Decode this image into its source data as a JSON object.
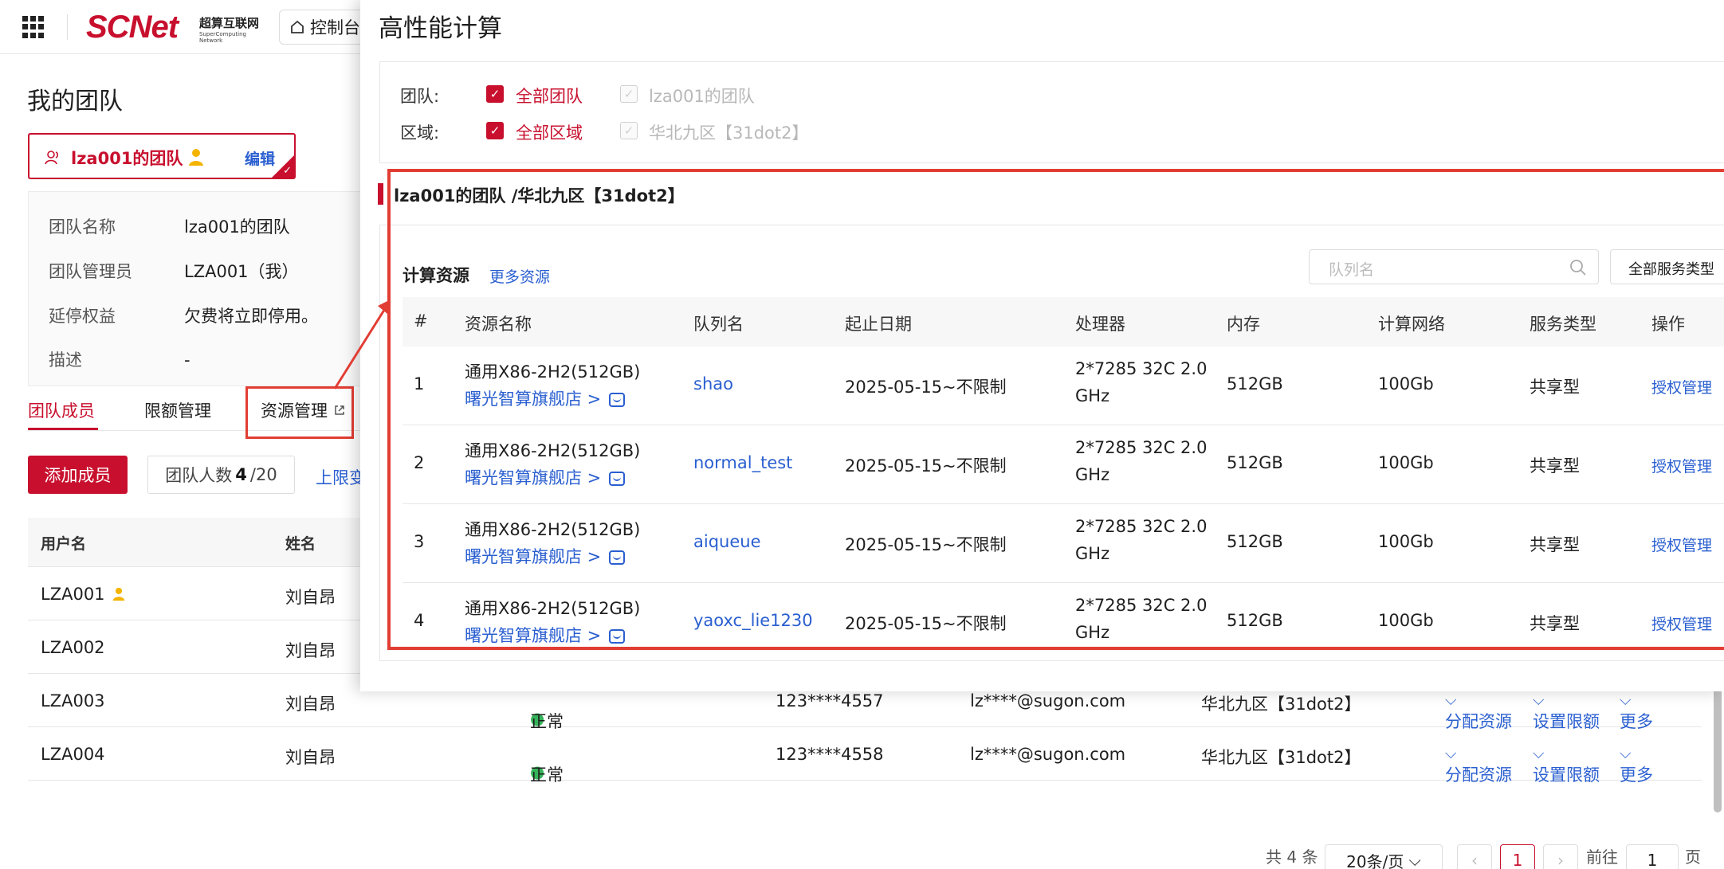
{
  "header": {
    "logo": "SCNet",
    "logo_cn": "超算互联网",
    "logo_en_1": "SuperComputing",
    "logo_en_2": "Network",
    "console_label": "控制台"
  },
  "page": {
    "title": "我的团队",
    "team_card": {
      "name": "lza001的团队",
      "edit_label": "编辑"
    },
    "info": [
      {
        "key": "团队名称",
        "value": "lza001的团队"
      },
      {
        "key": "团队管理员",
        "value": "LZA001（我）"
      },
      {
        "key": "延停权益",
        "value": "欠费将立即停用。"
      },
      {
        "key": "描述",
        "value": "-"
      }
    ],
    "tabs": [
      "团队成员",
      "限额管理",
      "资源管理"
    ],
    "add_member_label": "添加成员",
    "member_count_prefix": "团队人数",
    "member_count_value": "4",
    "member_count_suffix": "/20",
    "limit_link": "上限变",
    "table_headers": {
      "username": "用户名",
      "name": "姓名"
    },
    "members": [
      {
        "username": "LZA001",
        "name": "刘自昂",
        "status": "",
        "phone": "",
        "email": "",
        "region": ""
      },
      {
        "username": "LZA002",
        "name": "刘自昂",
        "status": "",
        "phone": "",
        "email": "",
        "region": ""
      },
      {
        "username": "LZA003",
        "name": "刘自昂",
        "status": "正常",
        "phone": "123****4557",
        "email": "lz****@sugon.com",
        "region": "华北九区【31dot2】"
      },
      {
        "username": "LZA004",
        "name": "刘自昂",
        "status": "正常",
        "phone": "123****4558",
        "email": "lz****@sugon.com",
        "region": "华北九区【31dot2】"
      }
    ],
    "row_ops": {
      "assign": "分配资源",
      "limit": "设置限额",
      "more": "更多"
    },
    "pager": {
      "total": "共 4 条",
      "page_size": "20条/页",
      "current": "1",
      "goto_prefix": "前往",
      "goto_value": "1",
      "goto_suffix": "页"
    }
  },
  "panel": {
    "title": "高性能计算",
    "filters": {
      "team_label": "团队:",
      "team_all": "全部团队",
      "team_option": "lza001的团队",
      "region_label": "区域:",
      "region_all": "全部区域",
      "region_option": "华北九区【31dot2】"
    },
    "section_title": "lza001的团队 /华北九区【31dot2】",
    "compute_title": "计算资源",
    "more_resources": "更多资源",
    "queue_placeholder": "队列名",
    "service_type_select": "全部服务类型",
    "columns": [
      "#",
      "资源名称",
      "队列名",
      "起止日期",
      "处理器",
      "内存",
      "计算网络",
      "服务类型",
      "操作"
    ],
    "rows": [
      {
        "idx": "1",
        "resource": "通用X86-2H2(512GB)",
        "store": "曙光智算旗舰店 >",
        "queue": "shao",
        "date": "2025-05-15~不限制",
        "cpu1": "2*7285 32C 2.0",
        "cpu2": "GHz",
        "mem": "512GB",
        "net": "100Gb",
        "type": "共享型",
        "op": "授权管理"
      },
      {
        "idx": "2",
        "resource": "通用X86-2H2(512GB)",
        "store": "曙光智算旗舰店 >",
        "queue": "normal_test",
        "date": "2025-05-15~不限制",
        "cpu1": "2*7285 32C 2.0",
        "cpu2": "GHz",
        "mem": "512GB",
        "net": "100Gb",
        "type": "共享型",
        "op": "授权管理"
      },
      {
        "idx": "3",
        "resource": "通用X86-2H2(512GB)",
        "store": "曙光智算旗舰店 >",
        "queue": "aiqueue",
        "date": "2025-05-15~不限制",
        "cpu1": "2*7285 32C 2.0",
        "cpu2": "GHz",
        "mem": "512GB",
        "net": "100Gb",
        "type": "共享型",
        "op": "授权管理"
      },
      {
        "idx": "4",
        "resource": "通用X86-2H2(512GB)",
        "store": "曙光智算旗舰店 >",
        "queue": "yaoxc_lie1230",
        "date": "2025-05-15~不限制",
        "cpu1": "2*7285 32C 2.0",
        "cpu2": "GHz",
        "mem": "512GB",
        "net": "100Gb",
        "type": "共享型",
        "op": "授权管理"
      }
    ]
  },
  "colors": {
    "brand": "#c8102e",
    "link": "#2a5fd0",
    "highlight": "#e23d33",
    "status_ok": "#35b35a"
  }
}
